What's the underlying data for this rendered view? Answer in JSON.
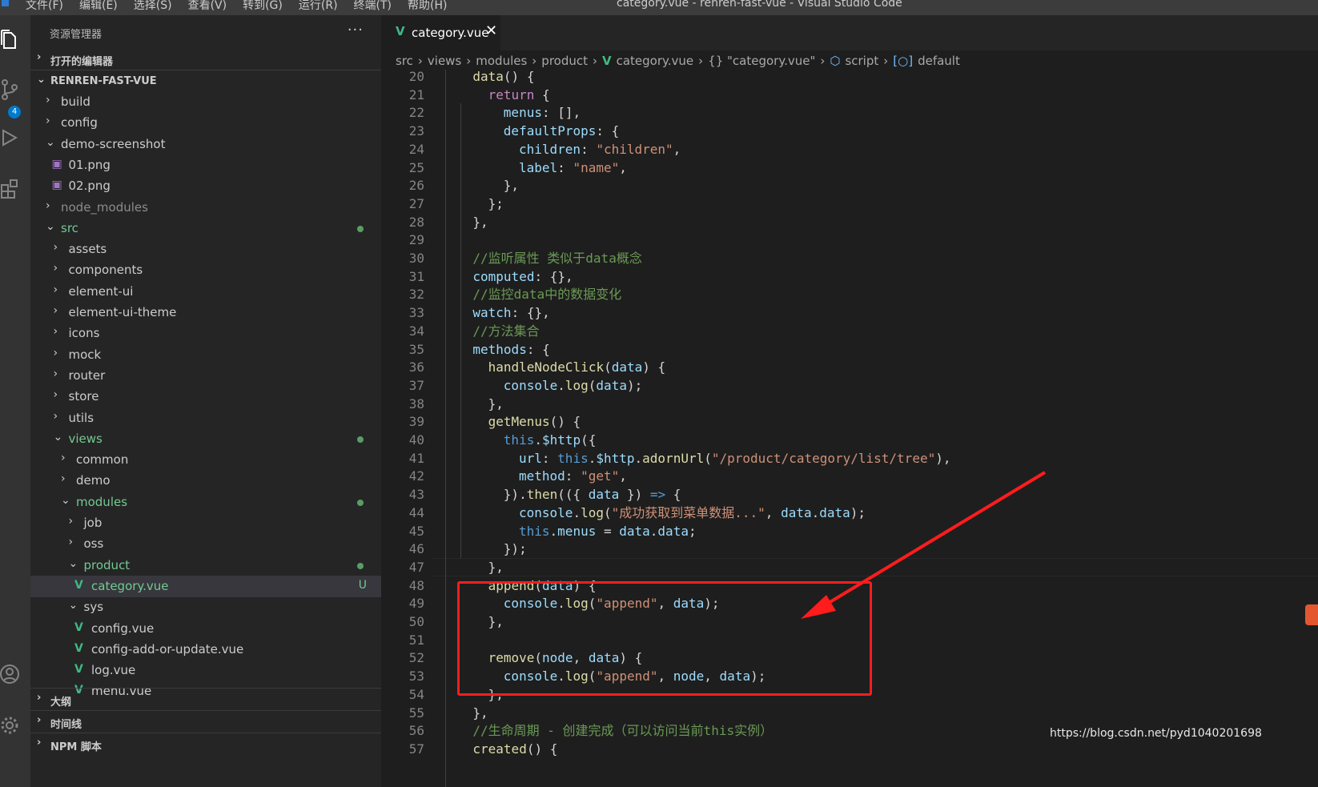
{
  "menubar": {
    "items": [
      "文件(F)",
      "编辑(E)",
      "选择(S)",
      "查看(V)",
      "转到(G)",
      "运行(R)",
      "终端(T)",
      "帮助(H)"
    ],
    "window_title": "category.vue - renren-fast-vue - Visual Studio Code"
  },
  "activity_bar": {
    "icons": [
      "explorer-icon",
      "source-control-icon",
      "run-debug-icon",
      "extensions-icon",
      "account-icon",
      "settings-gear-icon"
    ],
    "source_control_badge": "4"
  },
  "sidebar": {
    "title": "资源管理器",
    "more": "···",
    "open_editors": "打开的编辑器",
    "project": "RENREN-FAST-VUE",
    "tree": [
      {
        "label": "build",
        "depth": 1,
        "kind": "folder",
        "expanded": false
      },
      {
        "label": "config",
        "depth": 1,
        "kind": "folder",
        "expanded": false
      },
      {
        "label": "demo-screenshot",
        "depth": 1,
        "kind": "folder",
        "expanded": true
      },
      {
        "label": "01.png",
        "depth": 2,
        "kind": "png"
      },
      {
        "label": "02.png",
        "depth": 2,
        "kind": "png"
      },
      {
        "label": "node_modules",
        "depth": 1,
        "kind": "folder",
        "expanded": false,
        "dim": true
      },
      {
        "label": "src",
        "depth": 1,
        "kind": "folder",
        "expanded": true,
        "modified": true
      },
      {
        "label": "assets",
        "depth": 2,
        "kind": "folder",
        "expanded": false
      },
      {
        "label": "components",
        "depth": 2,
        "kind": "folder",
        "expanded": false
      },
      {
        "label": "element-ui",
        "depth": 2,
        "kind": "folder",
        "expanded": false
      },
      {
        "label": "element-ui-theme",
        "depth": 2,
        "kind": "folder",
        "expanded": false
      },
      {
        "label": "icons",
        "depth": 2,
        "kind": "folder",
        "expanded": false
      },
      {
        "label": "mock",
        "depth": 2,
        "kind": "folder",
        "expanded": false
      },
      {
        "label": "router",
        "depth": 2,
        "kind": "folder",
        "expanded": false
      },
      {
        "label": "store",
        "depth": 2,
        "kind": "folder",
        "expanded": false
      },
      {
        "label": "utils",
        "depth": 2,
        "kind": "folder",
        "expanded": false
      },
      {
        "label": "views",
        "depth": 2,
        "kind": "folder",
        "expanded": true,
        "modified": true
      },
      {
        "label": "common",
        "depth": 3,
        "kind": "folder",
        "expanded": false
      },
      {
        "label": "demo",
        "depth": 3,
        "kind": "folder",
        "expanded": false
      },
      {
        "label": "modules",
        "depth": 3,
        "kind": "folder",
        "expanded": true,
        "modified": true
      },
      {
        "label": "job",
        "depth": 4,
        "kind": "folder",
        "expanded": false
      },
      {
        "label": "oss",
        "depth": 4,
        "kind": "folder",
        "expanded": false
      },
      {
        "label": "product",
        "depth": 4,
        "kind": "folder",
        "expanded": true,
        "modified": true
      },
      {
        "label": "category.vue",
        "depth": 5,
        "kind": "vue",
        "status": "U",
        "selected": true
      },
      {
        "label": "sys",
        "depth": 4,
        "kind": "folder",
        "expanded": true
      },
      {
        "label": "config.vue",
        "depth": 5,
        "kind": "vue"
      },
      {
        "label": "config-add-or-update.vue",
        "depth": 5,
        "kind": "vue"
      },
      {
        "label": "log.vue",
        "depth": 5,
        "kind": "vue"
      },
      {
        "label": "menu.vue",
        "depth": 5,
        "kind": "vue"
      }
    ],
    "sections": [
      "大纲",
      "时间线",
      "NPM 脚本"
    ]
  },
  "editor": {
    "tab": {
      "label": "category.vue",
      "close": "✕"
    },
    "breadcrumbs": [
      "src",
      "views",
      "modules",
      "product",
      "category.vue",
      "{} \"category.vue\"",
      "script",
      "default"
    ],
    "lines": [
      {
        "n": "20",
        "i": 4,
        "tokens": [
          [
            "f",
            "data"
          ],
          [
            "t",
            "() {"
          ]
        ]
      },
      {
        "n": "21",
        "i": 6,
        "tokens": [
          [
            "k",
            "return"
          ],
          [
            "t",
            " {"
          ]
        ]
      },
      {
        "n": "22",
        "i": 8,
        "tokens": [
          [
            "p",
            "menus"
          ],
          [
            "t",
            ": [],"
          ]
        ]
      },
      {
        "n": "23",
        "i": 8,
        "tokens": [
          [
            "p",
            "defaultProps"
          ],
          [
            "t",
            ": {"
          ]
        ]
      },
      {
        "n": "24",
        "i": 10,
        "tokens": [
          [
            "p",
            "children"
          ],
          [
            "t",
            ": "
          ],
          [
            "s",
            "\"children\""
          ],
          [
            "t",
            ","
          ]
        ]
      },
      {
        "n": "25",
        "i": 10,
        "tokens": [
          [
            "p",
            "label"
          ],
          [
            "t",
            ": "
          ],
          [
            "s",
            "\"name\""
          ],
          [
            "t",
            ","
          ]
        ]
      },
      {
        "n": "26",
        "i": 8,
        "tokens": [
          [
            "t",
            "},"
          ]
        ]
      },
      {
        "n": "27",
        "i": 6,
        "tokens": [
          [
            "t",
            "};"
          ]
        ]
      },
      {
        "n": "28",
        "i": 4,
        "tokens": [
          [
            "t",
            "},"
          ]
        ]
      },
      {
        "n": "29",
        "i": 4,
        "tokens": []
      },
      {
        "n": "30",
        "i": 4,
        "tokens": [
          [
            "c",
            "//监听属性 类似于data概念"
          ]
        ]
      },
      {
        "n": "31",
        "i": 4,
        "tokens": [
          [
            "p",
            "computed"
          ],
          [
            "t",
            ": {},"
          ]
        ]
      },
      {
        "n": "32",
        "i": 4,
        "tokens": [
          [
            "c",
            "//监控data中的数据变化"
          ]
        ]
      },
      {
        "n": "33",
        "i": 4,
        "tokens": [
          [
            "p",
            "watch"
          ],
          [
            "t",
            ": {},"
          ]
        ]
      },
      {
        "n": "34",
        "i": 4,
        "tokens": [
          [
            "c",
            "//方法集合"
          ]
        ]
      },
      {
        "n": "35",
        "i": 4,
        "tokens": [
          [
            "p",
            "methods"
          ],
          [
            "t",
            ": {"
          ]
        ]
      },
      {
        "n": "36",
        "i": 6,
        "tokens": [
          [
            "f",
            "handleNodeClick"
          ],
          [
            "t",
            "("
          ],
          [
            "p",
            "data"
          ],
          [
            "t",
            ") {"
          ]
        ]
      },
      {
        "n": "37",
        "i": 8,
        "tokens": [
          [
            "p",
            "console"
          ],
          [
            "t",
            "."
          ],
          [
            "f",
            "log"
          ],
          [
            "t",
            "("
          ],
          [
            "p",
            "data"
          ],
          [
            "t",
            ");"
          ]
        ]
      },
      {
        "n": "38",
        "i": 6,
        "tokens": [
          [
            "t",
            "},"
          ]
        ]
      },
      {
        "n": "39",
        "i": 6,
        "tokens": [
          [
            "f",
            "getMenus"
          ],
          [
            "t",
            "() {"
          ]
        ]
      },
      {
        "n": "40",
        "i": 8,
        "tokens": [
          [
            "kw",
            "this"
          ],
          [
            "t",
            "."
          ],
          [
            "p",
            "$http"
          ],
          [
            "t",
            "({"
          ]
        ]
      },
      {
        "n": "41",
        "i": 10,
        "tokens": [
          [
            "p",
            "url"
          ],
          [
            "t",
            ": "
          ],
          [
            "kw",
            "this"
          ],
          [
            "t",
            "."
          ],
          [
            "p",
            "$http"
          ],
          [
            "t",
            "."
          ],
          [
            "f",
            "adornUrl"
          ],
          [
            "t",
            "("
          ],
          [
            "s",
            "\"/product/category/list/tree\""
          ],
          [
            "t",
            "),"
          ]
        ]
      },
      {
        "n": "42",
        "i": 10,
        "tokens": [
          [
            "p",
            "method"
          ],
          [
            "t",
            ": "
          ],
          [
            "s",
            "\"get\""
          ],
          [
            "t",
            ","
          ]
        ]
      },
      {
        "n": "43",
        "i": 8,
        "tokens": [
          [
            "t",
            "})."
          ],
          [
            "f",
            "then"
          ],
          [
            "t",
            "(({ "
          ],
          [
            "p",
            "data"
          ],
          [
            "t",
            " }) "
          ],
          [
            "kw",
            "=>"
          ],
          [
            "t",
            " {"
          ]
        ]
      },
      {
        "n": "44",
        "i": 10,
        "tokens": [
          [
            "p",
            "console"
          ],
          [
            "t",
            "."
          ],
          [
            "f",
            "log"
          ],
          [
            "t",
            "("
          ],
          [
            "s",
            "\"成功获取到菜单数据...\""
          ],
          [
            "t",
            ", "
          ],
          [
            "p",
            "data"
          ],
          [
            "t",
            "."
          ],
          [
            "p",
            "data"
          ],
          [
            "t",
            ");"
          ]
        ]
      },
      {
        "n": "45",
        "i": 10,
        "tokens": [
          [
            "kw",
            "this"
          ],
          [
            "t",
            "."
          ],
          [
            "p",
            "menus"
          ],
          [
            "t",
            " = "
          ],
          [
            "p",
            "data"
          ],
          [
            "t",
            "."
          ],
          [
            "p",
            "data"
          ],
          [
            "t",
            ";"
          ]
        ]
      },
      {
        "n": "46",
        "i": 8,
        "tokens": [
          [
            "t",
            "});"
          ]
        ]
      },
      {
        "n": "47",
        "i": 6,
        "tokens": [
          [
            "t",
            "},"
          ]
        ]
      },
      {
        "n": "48",
        "i": 6,
        "tokens": [
          [
            "f",
            "append"
          ],
          [
            "t",
            "("
          ],
          [
            "p",
            "data"
          ],
          [
            "t",
            ") {"
          ]
        ]
      },
      {
        "n": "49",
        "i": 8,
        "tokens": [
          [
            "p",
            "console"
          ],
          [
            "t",
            "."
          ],
          [
            "f",
            "log"
          ],
          [
            "t",
            "("
          ],
          [
            "s",
            "\"append\""
          ],
          [
            "t",
            ", "
          ],
          [
            "p",
            "data"
          ],
          [
            "t",
            ");"
          ]
        ]
      },
      {
        "n": "50",
        "i": 6,
        "tokens": [
          [
            "t",
            "},"
          ]
        ]
      },
      {
        "n": "51",
        "i": 6,
        "tokens": []
      },
      {
        "n": "52",
        "i": 6,
        "tokens": [
          [
            "f",
            "remove"
          ],
          [
            "t",
            "("
          ],
          [
            "p",
            "node"
          ],
          [
            "t",
            ", "
          ],
          [
            "p",
            "data"
          ],
          [
            "t",
            ") {"
          ]
        ]
      },
      {
        "n": "53",
        "i": 8,
        "tokens": [
          [
            "p",
            "console"
          ],
          [
            "t",
            "."
          ],
          [
            "f",
            "log"
          ],
          [
            "t",
            "("
          ],
          [
            "s",
            "\"append\""
          ],
          [
            "t",
            ", "
          ],
          [
            "p",
            "node"
          ],
          [
            "t",
            ", "
          ],
          [
            "p",
            "data"
          ],
          [
            "t",
            ");"
          ]
        ]
      },
      {
        "n": "54",
        "i": 6,
        "tokens": [
          [
            "t",
            "},"
          ]
        ]
      },
      {
        "n": "55",
        "i": 4,
        "tokens": [
          [
            "t",
            "},"
          ]
        ]
      },
      {
        "n": "56",
        "i": 4,
        "tokens": [
          [
            "c",
            "//生命周期 - 创建完成（可以访问当前this实例）"
          ]
        ]
      },
      {
        "n": "57",
        "i": 4,
        "tokens": [
          [
            "f",
            "created"
          ],
          [
            "t",
            "() {"
          ]
        ]
      }
    ]
  },
  "watermark": "https://blog.csdn.net/pyd1040201698",
  "colors": {
    "keyword": "#c586c0",
    "storage": "#569cd6",
    "property": "#9cdcfe",
    "function": "#dcdcaa",
    "string": "#ce9178",
    "comment": "#6a9955",
    "annotation": "#ff1c1c"
  }
}
